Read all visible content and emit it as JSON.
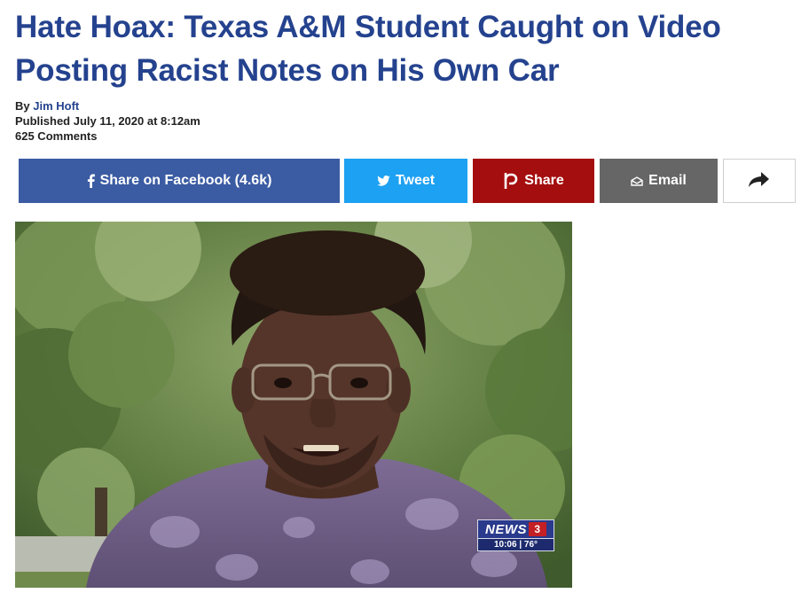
{
  "article": {
    "title": "Hate Hoax: Texas A&M Student Caught on Video Posting Racist Notes on His Own Car",
    "byline_prefix": "By",
    "author": "Jim Hoft",
    "published": "Published July 11, 2020 at 8:12am",
    "comments": "625 Comments"
  },
  "share": {
    "facebook_label": "Share on Facebook (4.6k)",
    "twitter_label": "Tweet",
    "parler_label": "Share",
    "email_label": "Email",
    "facebook_icon": "facebook-icon",
    "twitter_icon": "twitter-icon",
    "parler_icon": "parler-icon",
    "email_icon": "envelope-icon",
    "more_icon": "share-arrow-icon"
  },
  "video_overlay": {
    "logo_text": "NEWS",
    "logo_number": "3",
    "time": "10:06",
    "temp": "76°"
  },
  "colors": {
    "headline": "#24428e",
    "facebook": "#3b5ba3",
    "twitter": "#1da1f2",
    "parler": "#a50e0e",
    "email": "#666666"
  }
}
